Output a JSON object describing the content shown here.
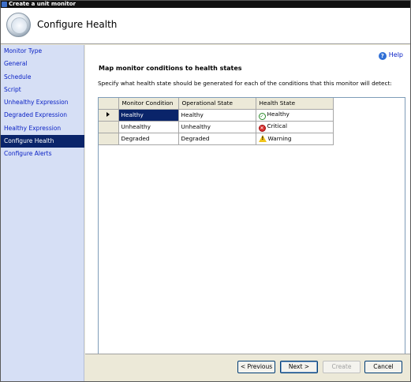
{
  "window": {
    "title": "Create a unit monitor"
  },
  "header": {
    "title": "Configure Health"
  },
  "sidebar": {
    "items": [
      {
        "label": "Monitor Type",
        "active": false
      },
      {
        "label": "General",
        "active": false
      },
      {
        "label": "Schedule",
        "active": false
      },
      {
        "label": "Script",
        "active": false
      },
      {
        "label": "Unhealthy Expression",
        "active": false
      },
      {
        "label": "Degraded Expression",
        "active": false
      },
      {
        "label": "Healthy Expression",
        "active": false
      },
      {
        "label": "Configure Health",
        "active": true
      },
      {
        "label": "Configure Alerts",
        "active": false
      }
    ]
  },
  "main": {
    "help_label": "Help",
    "section_title": "Map monitor conditions to health states",
    "description": "Specify what health state should be generated for each of the conditions that this monitor will detect:",
    "table": {
      "columns": [
        "Monitor Condition",
        "Operational State",
        "Health State"
      ],
      "rows": [
        {
          "condition": "Healthy",
          "operational_state": "Healthy",
          "health_state": "Healthy",
          "icon": "check-icon",
          "selected": true
        },
        {
          "condition": "Unhealthy",
          "operational_state": "Unhealthy",
          "health_state": "Critical",
          "icon": "critical-icon",
          "selected": false
        },
        {
          "condition": "Degraded",
          "operational_state": "Degraded",
          "health_state": "Warning",
          "icon": "warning-icon",
          "selected": false
        }
      ]
    }
  },
  "footer": {
    "previous_label": "< Previous",
    "next_label": "Next >",
    "create_label": "Create",
    "cancel_label": "Cancel"
  },
  "colors": {
    "selection": "#0a246a",
    "sidebar_bg": "#d6dff5",
    "link": "#0b22c5"
  }
}
